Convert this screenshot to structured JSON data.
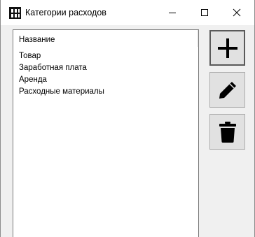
{
  "window": {
    "title": "Категории расходов",
    "icon": "app-grid-icon",
    "controls": {
      "minimize_icon": "minimize-icon",
      "maximize_icon": "maximize-icon",
      "close_icon": "close-icon"
    }
  },
  "list": {
    "column_header": "Название",
    "items": [
      "Товар",
      "Заработная плата",
      "Аренда",
      "Расходные материалы"
    ]
  },
  "actions": [
    {
      "name": "add",
      "icon": "plus-icon"
    },
    {
      "name": "edit",
      "icon": "pencil-icon"
    },
    {
      "name": "delete",
      "icon": "trash-icon"
    }
  ],
  "colors": {
    "titlebar_bg": "#ffffff",
    "window_bg": "#f0f0f0",
    "button_bg": "#e1e1e1",
    "icon_color": "#000000"
  }
}
